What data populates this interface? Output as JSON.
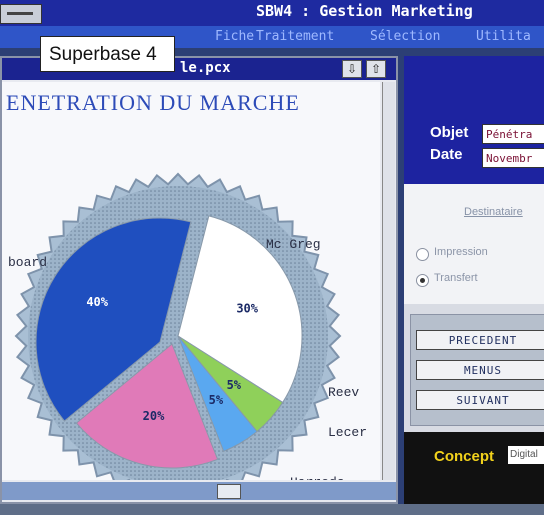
{
  "window": {
    "title": "SBW4 : Gestion Marketing"
  },
  "menu": {
    "items": [
      "Fiche",
      "Traitement",
      "Sélection",
      "Utilita"
    ]
  },
  "caption": "Superbase 4",
  "document": {
    "filename": "le.pcx",
    "heading": "ENETRATION DU MARCHE",
    "scroll_up_icon": "arrow-up-icon",
    "scroll_down_icon": "arrow-down-icon"
  },
  "chart_data": {
    "type": "pie",
    "title": "ENETRATION DU MARCHE",
    "slices": [
      {
        "label": "board",
        "value": 40,
        "data_label": "40%",
        "color": "#1f4fbf"
      },
      {
        "label": "Mc Greg",
        "value": 30,
        "data_label": "30%",
        "color": "#ffffff"
      },
      {
        "label": "Reev",
        "value": 5,
        "data_label": "5%",
        "color": "#8fd05a"
      },
      {
        "label": "Lecer",
        "value": 5,
        "data_label": "5%",
        "color": "#5aa8f0"
      },
      {
        "label": "Harrods",
        "value": 20,
        "data_label": "20%",
        "color": "#e07ab8"
      }
    ]
  },
  "panel": {
    "objet_label": "Objet",
    "objet_value": "Pénétra",
    "date_label": "Date",
    "date_value": "Novembr",
    "destinataire": "Destinataire",
    "radio_impression": "Impression",
    "radio_transfert": "Transfert",
    "selected_radio": "Transfert",
    "buttons": {
      "precedent": "PRECEDENT",
      "menus": "MENUS",
      "suivant": "SUIVANT"
    },
    "concept_label": "Concept",
    "concept_value": "Digital"
  }
}
